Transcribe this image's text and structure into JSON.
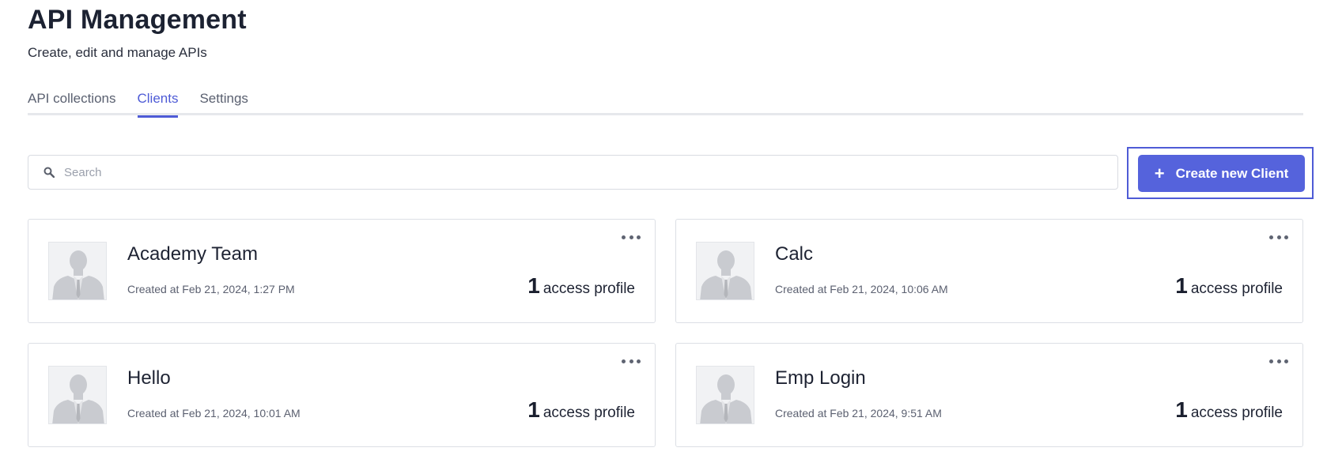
{
  "header": {
    "title": "API Management",
    "subtitle": "Create, edit and manage APIs"
  },
  "tabs": [
    {
      "label": "API collections",
      "active": false
    },
    {
      "label": "Clients",
      "active": true
    },
    {
      "label": "Settings",
      "active": false
    }
  ],
  "search": {
    "placeholder": "Search",
    "value": "",
    "icon": "search-icon"
  },
  "create_button": {
    "label": "Create new Client",
    "icon": "plus-icon"
  },
  "colors": {
    "accent": "#4e5bd6",
    "button": "#5563dc"
  },
  "clients": [
    {
      "name": "Academy Team",
      "created": "Created at Feb 21, 2024, 1:27 PM",
      "access_count": "1",
      "access_label": "access profile"
    },
    {
      "name": "Calc",
      "created": "Created at Feb 21, 2024, 10:06 AM",
      "access_count": "1",
      "access_label": "access profile"
    },
    {
      "name": "Hello",
      "created": "Created at Feb 21, 2024, 10:01 AM",
      "access_count": "1",
      "access_label": "access profile"
    },
    {
      "name": "Emp Login",
      "created": "Created at Feb 21, 2024, 9:51 AM",
      "access_count": "1",
      "access_label": "access profile"
    }
  ]
}
